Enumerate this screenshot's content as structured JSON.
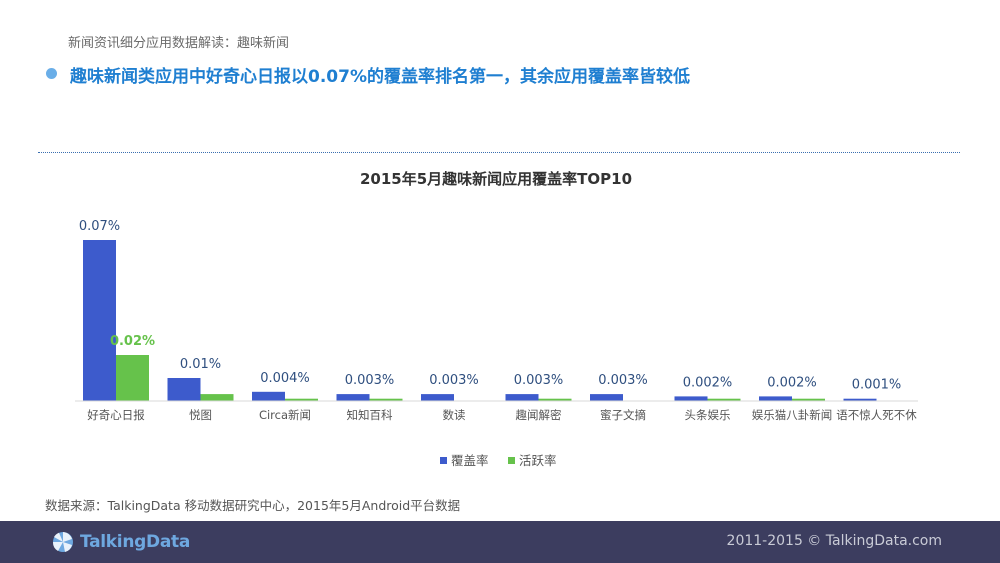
{
  "header": {
    "breadcrumb": "新闻资讯细分应用数据解读：趣味新闻",
    "headline": "趣味新闻类应用中好奇心日报以0.07%的覆盖率排名第一，其余应用覆盖率皆较低"
  },
  "colors": {
    "accent": "#1f7fd1",
    "dot": "#6aaee8",
    "coverage": "#3d5bcc",
    "activity": "#66c24b",
    "footer_bg": "#3c3d5f"
  },
  "chart_data": {
    "type": "bar",
    "title": "2015年5月趣味新闻应用覆盖率TOP10",
    "categories": [
      "好奇心日报",
      "悦图",
      "Circa新闻",
      "知知百科",
      "数读",
      "趣闻解密",
      "蜜子文摘",
      "头条娱乐",
      "娱乐猫八卦新闻",
      "语不惊人死不休"
    ],
    "series": [
      {
        "name": "覆盖率",
        "values": [
          0.07,
          0.01,
          0.004,
          0.003,
          0.003,
          0.003,
          0.003,
          0.002,
          0.002,
          0.001
        ],
        "labels": [
          "0.07%",
          "0.01%",
          "0.004%",
          "0.003%",
          "0.003%",
          "0.003%",
          "0.003%",
          "0.002%",
          "0.002%",
          "0.001%"
        ]
      },
      {
        "name": "活跃率",
        "values": [
          0.02,
          0.003,
          0.001,
          0.001,
          0,
          0.001,
          0,
          0.001,
          0.001,
          0
        ],
        "labels": [
          "0.02%",
          "",
          "",
          "",
          "",
          "",
          "",
          "",
          "",
          ""
        ]
      }
    ],
    "ylim": [
      0,
      0.07
    ],
    "grid": false,
    "legend": "bottom"
  },
  "source_note": "数据来源：TalkingData 移动数据研究中心，2015年5月Android平台数据",
  "footer": {
    "logo_text": "TalkingData",
    "copyright": "2011-2015 © TalkingData.com"
  }
}
